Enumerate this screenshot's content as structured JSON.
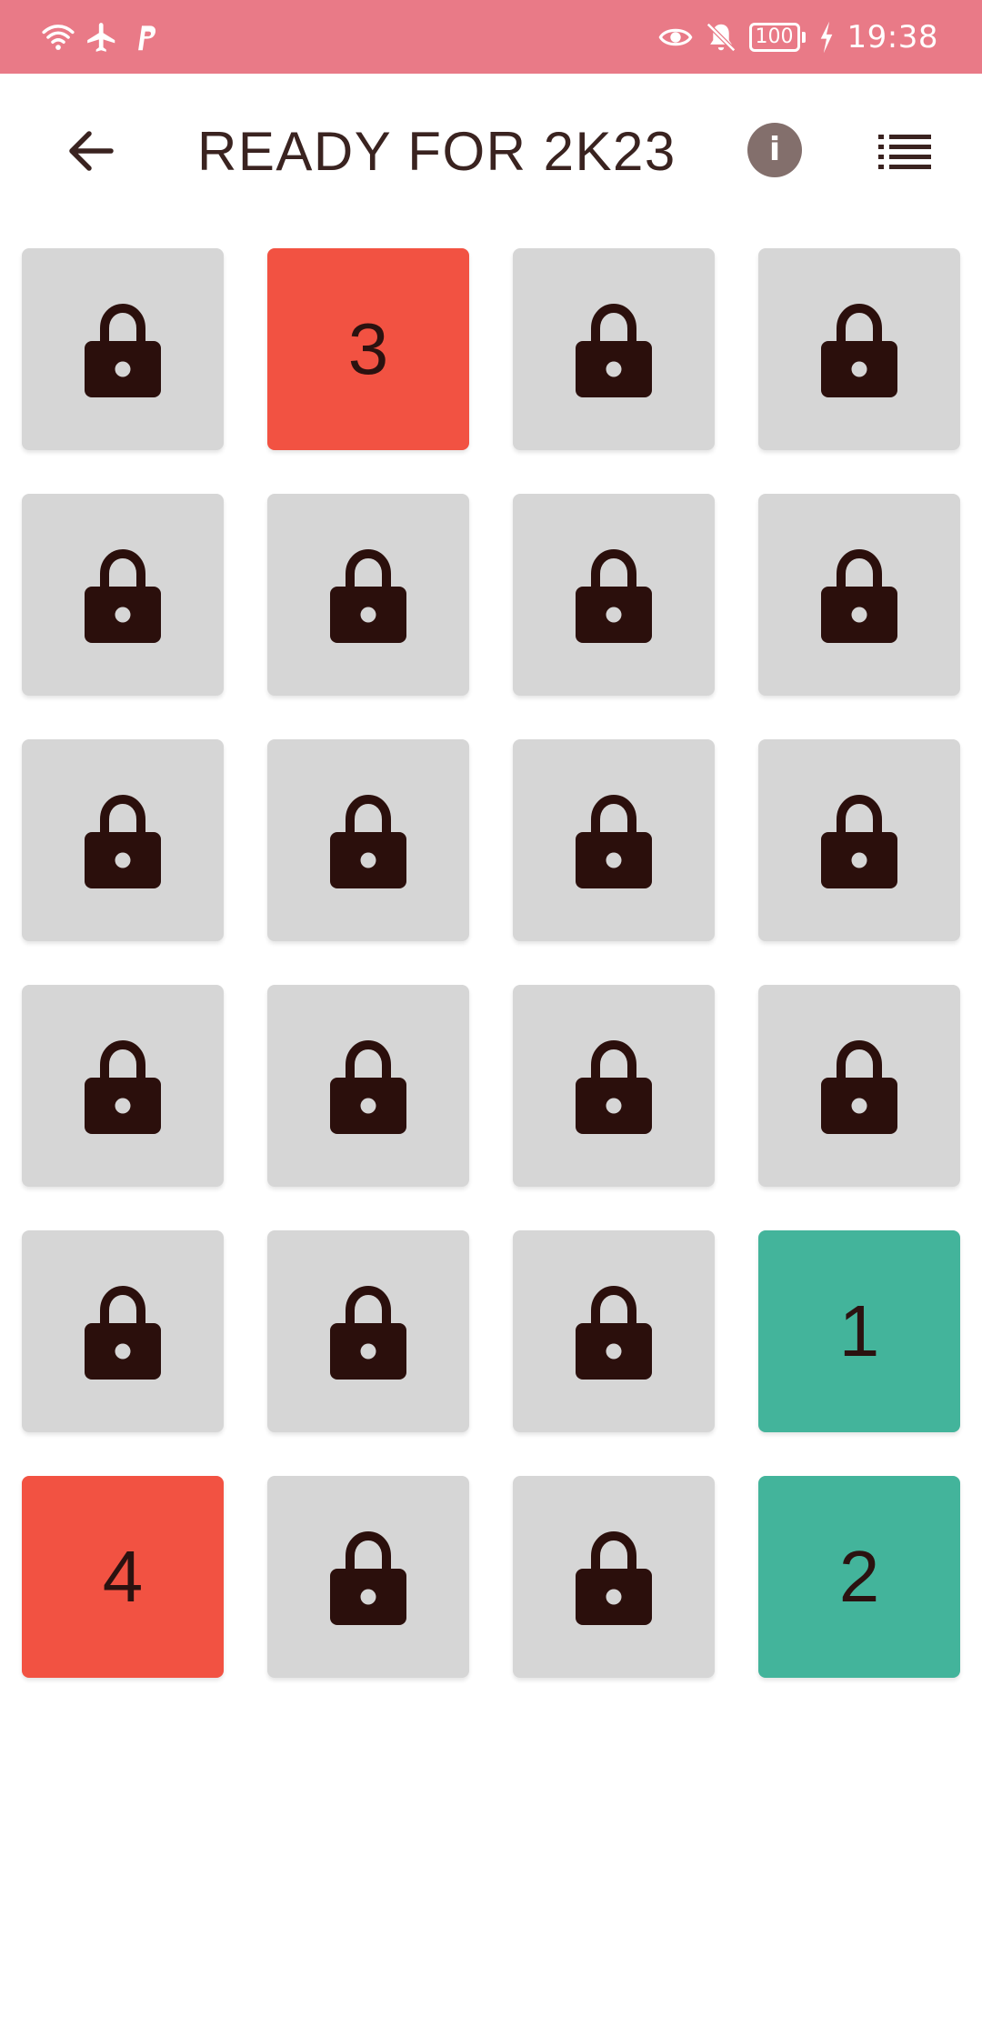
{
  "status_bar": {
    "time": "19:38",
    "battery": "100",
    "icons_left": [
      "wifi-icon",
      "airplane-icon",
      "paypal-icon"
    ],
    "icons_right": [
      "eye-icon",
      "bell-off-icon",
      "battery-icon",
      "charging-icon"
    ]
  },
  "app_bar": {
    "title": "READY FOR 2K23",
    "info_label": "i",
    "icons": [
      "back-arrow-icon",
      "info-icon",
      "list-icon"
    ]
  },
  "tiles": [
    {
      "state": "locked",
      "label": ""
    },
    {
      "state": "red",
      "label": "3"
    },
    {
      "state": "locked",
      "label": ""
    },
    {
      "state": "locked",
      "label": ""
    },
    {
      "state": "locked",
      "label": ""
    },
    {
      "state": "locked",
      "label": ""
    },
    {
      "state": "locked",
      "label": ""
    },
    {
      "state": "locked",
      "label": ""
    },
    {
      "state": "locked",
      "label": ""
    },
    {
      "state": "locked",
      "label": ""
    },
    {
      "state": "locked",
      "label": ""
    },
    {
      "state": "locked",
      "label": ""
    },
    {
      "state": "locked",
      "label": ""
    },
    {
      "state": "locked",
      "label": ""
    },
    {
      "state": "locked",
      "label": ""
    },
    {
      "state": "locked",
      "label": ""
    },
    {
      "state": "locked",
      "label": ""
    },
    {
      "state": "locked",
      "label": ""
    },
    {
      "state": "locked",
      "label": ""
    },
    {
      "state": "green",
      "label": "1"
    },
    {
      "state": "red",
      "label": "4"
    },
    {
      "state": "locked",
      "label": ""
    },
    {
      "state": "locked",
      "label": ""
    },
    {
      "state": "green",
      "label": "2"
    }
  ],
  "colors": {
    "status_bar": "#e97a87",
    "title_text": "#3a2320",
    "locked_tile": "#d6d6d6",
    "red_tile": "#f25242",
    "green_tile": "#43b49b",
    "lock_icon": "#2b0f0c",
    "info_circle": "#836f6c"
  }
}
